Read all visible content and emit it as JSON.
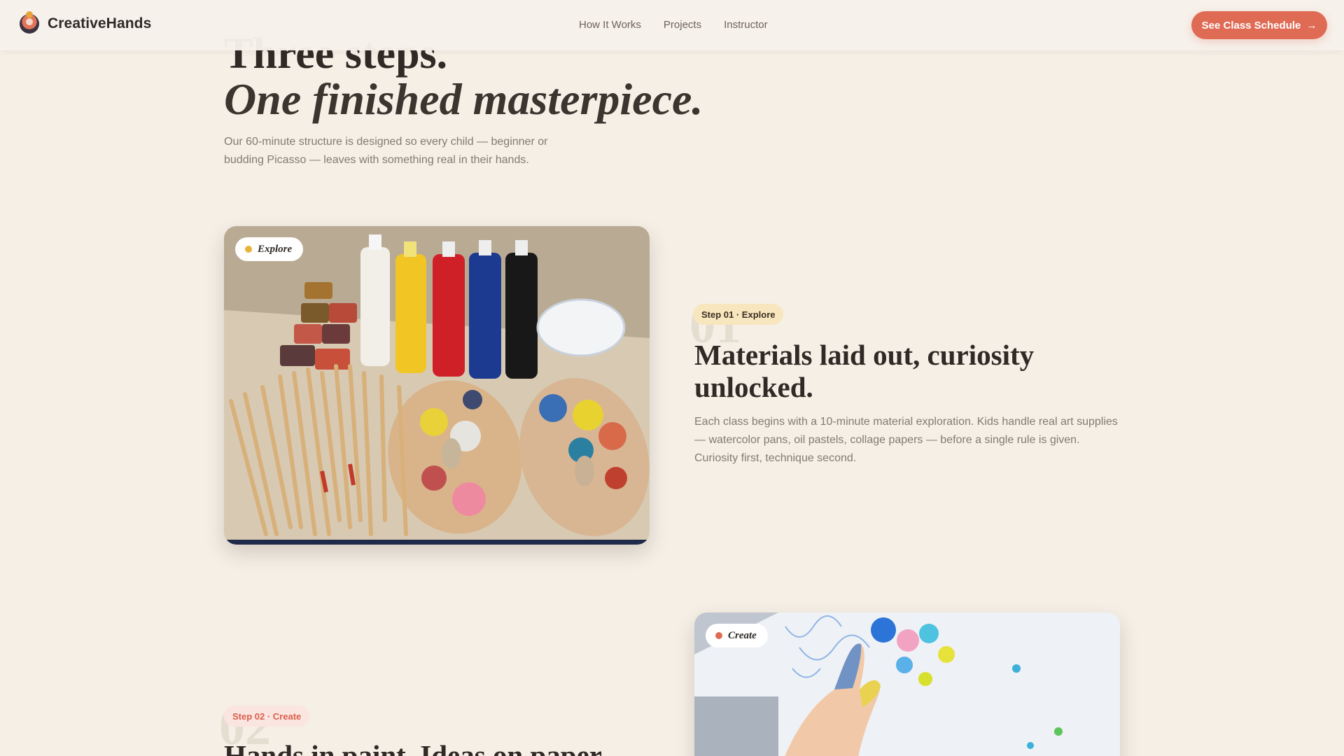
{
  "header": {
    "brand": "CreativeHands",
    "nav": [
      "How It Works",
      "Projects",
      "Instructor"
    ],
    "cta_label": "See Class Schedule"
  },
  "hero": {
    "title_line1": "Three steps.",
    "title_line2": "One finished masterpiece.",
    "subtitle": "Our 60-minute structure is designed so every child — beginner or budding Picasso — leaves with something real in their hands."
  },
  "steps": [
    {
      "chip": "Explore",
      "number": "01",
      "badge": "Step 01 · Explore",
      "title": "Materials laid out, curiosity unlocked.",
      "body": "Each class begins with a 10-minute material exploration. Kids handle real art supplies — watercolor pans, oil pastels, collage papers — before a single rule is given. Curiosity first, technique second."
    },
    {
      "chip": "Create",
      "number": "02",
      "badge": "Step 02 · Create",
      "title": "Hands in paint. Ideas on paper."
    }
  ],
  "colors": {
    "accent": "#e06b55",
    "background": "#f5efe6",
    "explore_dot": "#e8b33a",
    "create_dot": "#e06b55"
  },
  "icons": {
    "logo": "paint-palette-logo",
    "cta": "arrow-right-icon"
  }
}
